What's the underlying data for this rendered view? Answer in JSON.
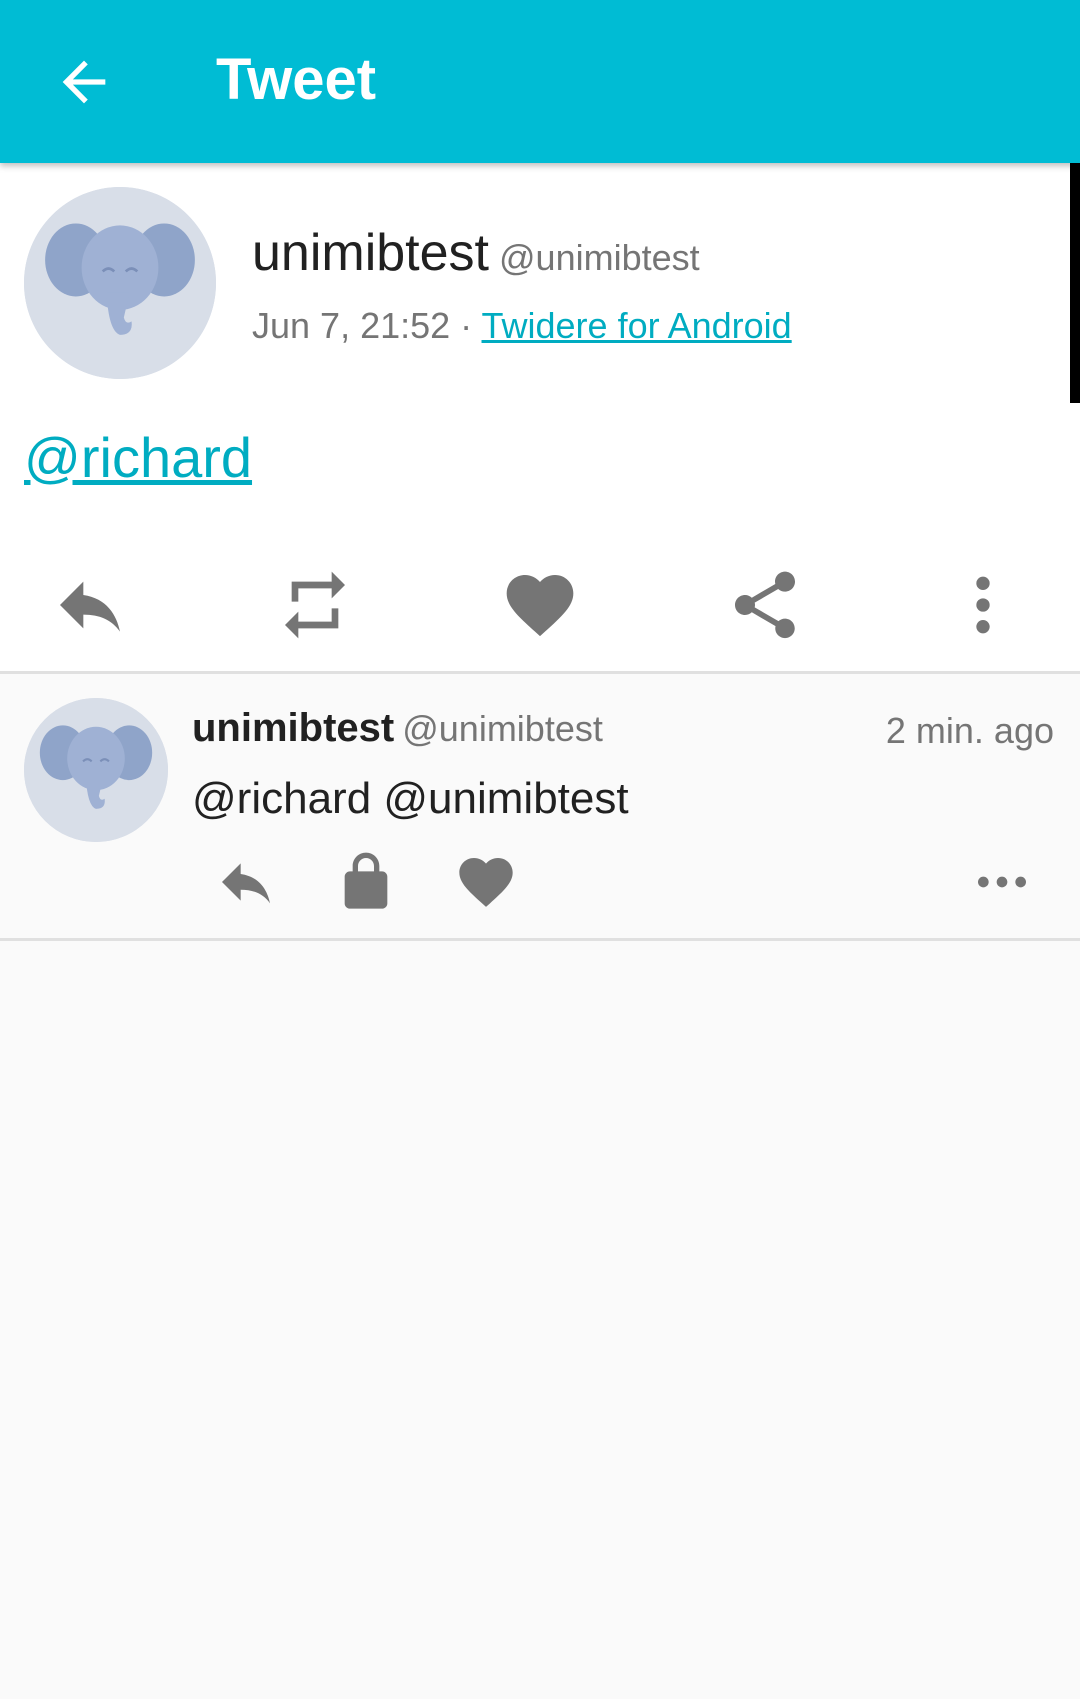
{
  "appbar": {
    "title": "Tweet"
  },
  "status": {
    "name": "unimibtest",
    "handle": "@unimibtest",
    "time": "Jun 7, 21:52",
    "separator": " · ",
    "source": "Twidere for Android",
    "text": "@richard"
  },
  "reply": {
    "name": "unimibtest",
    "handle": "@unimibtest",
    "time": "2 min. ago",
    "text": "@richard @unimibtest"
  },
  "colors": {
    "accent": "#00bcd4",
    "link": "#00acc1",
    "icon": "#757575"
  },
  "icons": {
    "back": "arrow-left-icon",
    "actions": [
      "reply-icon",
      "retweet-icon",
      "heart-icon",
      "share-icon",
      "more-vertical-icon"
    ],
    "reply_actions": [
      "reply-icon",
      "lock-icon",
      "heart-icon",
      "more-horizontal-icon"
    ]
  }
}
